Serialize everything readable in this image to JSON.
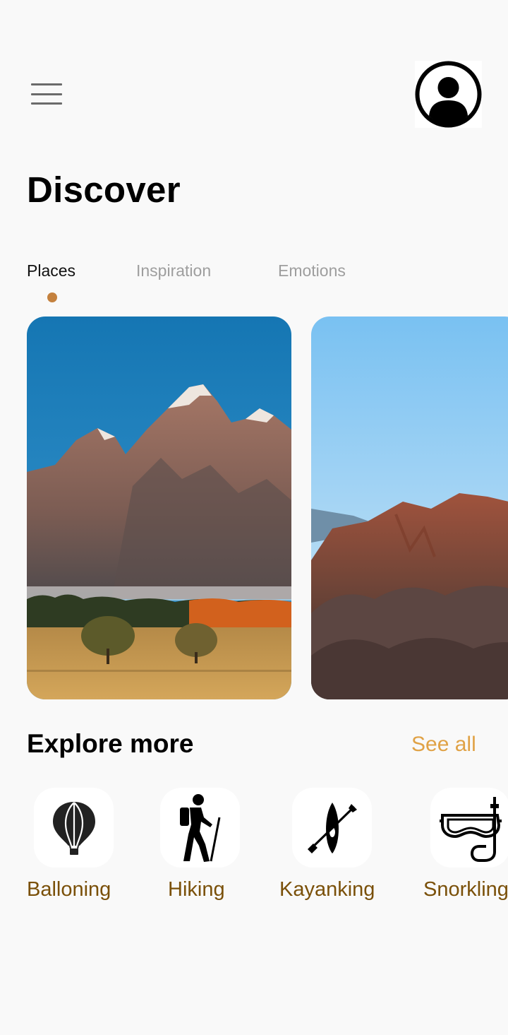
{
  "header": {
    "menu_icon": "hamburger-menu-icon",
    "avatar_icon": "user-profile-icon"
  },
  "page": {
    "title": "Discover"
  },
  "tabs": [
    {
      "label": "Places",
      "active": true
    },
    {
      "label": "Inspiration",
      "active": false
    },
    {
      "label": "Emotions",
      "active": false
    }
  ],
  "colors": {
    "accent": "#c4813e",
    "see_all": "#e0a246",
    "category_label": "#7a5009",
    "inactive_tab": "#9e9e9e",
    "background": "#f9f9f9"
  },
  "places": [
    {
      "image": "snowy-mountain-peaks-photo"
    },
    {
      "image": "desert-badlands-photo"
    }
  ],
  "explore": {
    "title": "Explore more",
    "see_all_label": "See all",
    "categories": [
      {
        "label": "Balloning",
        "icon": "hot-air-balloon-icon"
      },
      {
        "label": "Hiking",
        "icon": "hiker-icon"
      },
      {
        "label": "Kayanking",
        "icon": "kayak-icon"
      },
      {
        "label": "Snorkling",
        "icon": "snorkel-mask-icon"
      }
    ]
  }
}
